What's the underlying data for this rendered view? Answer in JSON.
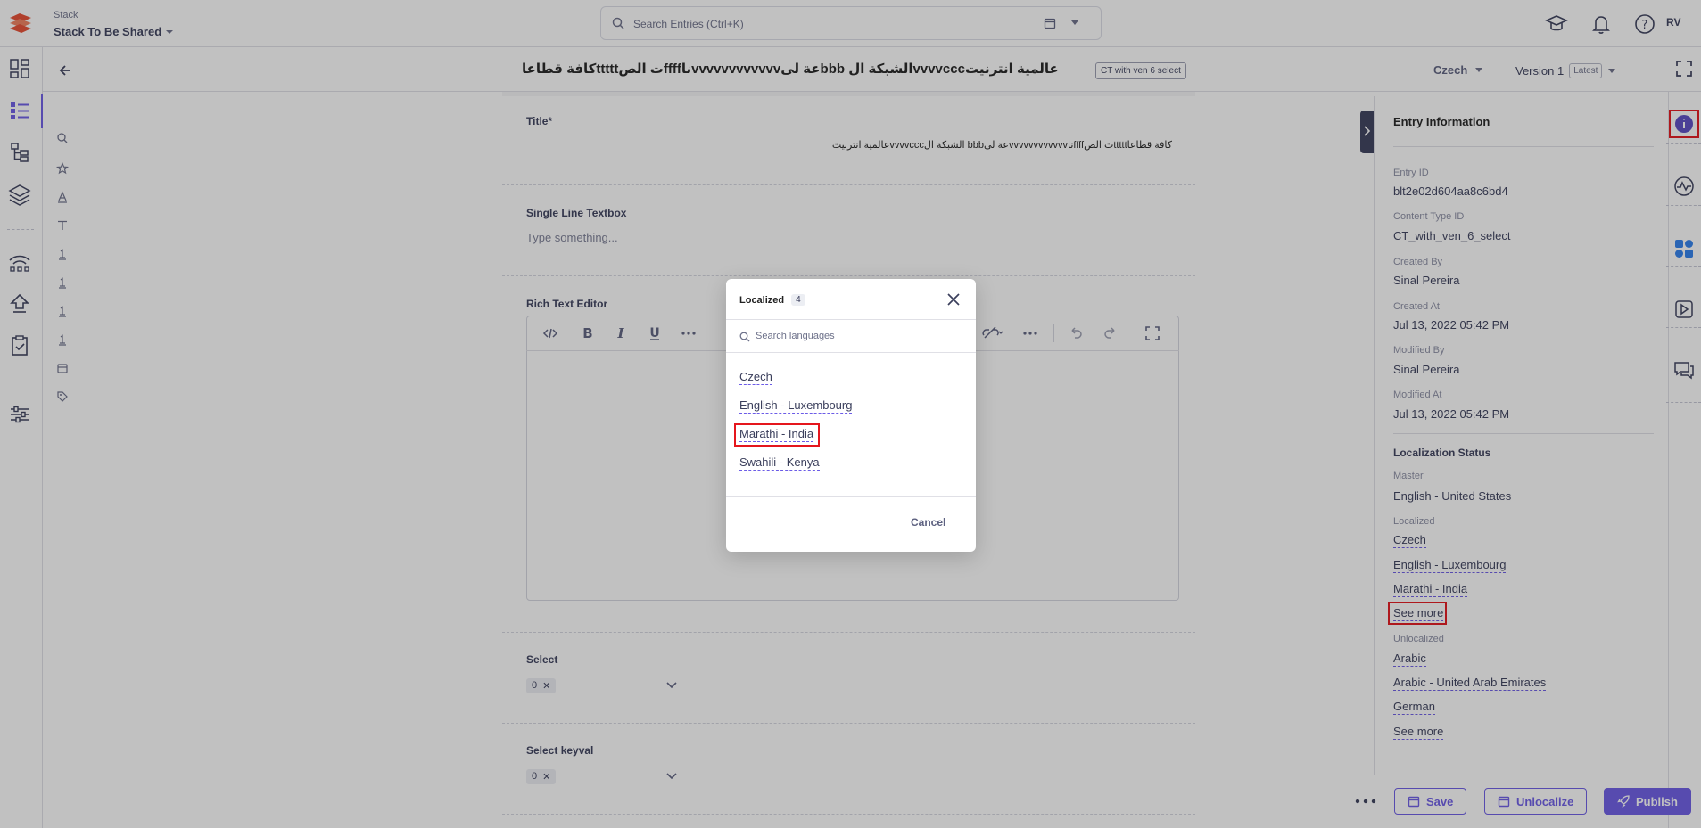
{
  "header": {
    "stack_caption": "Stack",
    "stack_name": "Stack To Be Shared",
    "search_placeholder": "Search Entries (Ctrl+K)",
    "avatar": "RV"
  },
  "entry": {
    "title": "عالمیة انترنیتvvvvcccالشبكة ال bbbعة لىvvvvvvvvvvvvناffffت الصtttttكافة قطاعا",
    "content_type_badge": "CT with ven 6 select",
    "language": "Czech",
    "version": "Version 1",
    "version_badge": "Latest"
  },
  "form": {
    "title_label": "Title*",
    "title_value": "كافة قطاعاtttttت الصffffناvvvvvvvvvvvvعة لىbbb الشبكة الvvvvcccعالمیة انترنیت",
    "single_line_label": "Single Line Textbox",
    "single_line_placeholder": "Type something...",
    "rte_label": "Rich Text Editor",
    "select_label": "Select",
    "select_value": "0",
    "select_keyval_label": "Select keyval",
    "select_keyval_value": "0"
  },
  "entry_info": {
    "title": "Entry Information",
    "entry_id_label": "Entry ID",
    "entry_id": "blt2e02d604aa8c6bd4",
    "content_type_id_label": "Content Type ID",
    "content_type_id": "CT_with_ven_6_select",
    "created_by_label": "Created By",
    "created_by": "Sinal Pereira",
    "created_at_label": "Created At",
    "created_at": "Jul 13, 2022 05:42 PM",
    "modified_by_label": "Modified By",
    "modified_by": "Sinal Pereira",
    "modified_at_label": "Modified At",
    "modified_at": "Jul 13, 2022 05:42 PM",
    "loc_status_title": "Localization Status",
    "master_label": "Master",
    "master": "English - United States",
    "localized_label": "Localized",
    "localized": [
      "Czech",
      "English - Luxembourg",
      "Marathi - India"
    ],
    "see_more": "See more",
    "unlocalized_label": "Unlocalized",
    "unlocalized": [
      "Arabic",
      "Arabic - United Arab Emirates",
      "German"
    ],
    "see_more_2": "See more"
  },
  "actions": {
    "save": "Save",
    "unlocalize": "Unlocalize",
    "publish": "Publish"
  },
  "modal": {
    "title": "Localized",
    "count": "4",
    "search_placeholder": "Search languages",
    "languages": [
      "Czech",
      "English - Luxembourg",
      "Marathi - India",
      "Swahili - Kenya"
    ],
    "cancel": "Cancel"
  },
  "colors": {
    "accent": "#6c5ce7",
    "highlight": "#e5161d",
    "brand": "#e84d32"
  }
}
